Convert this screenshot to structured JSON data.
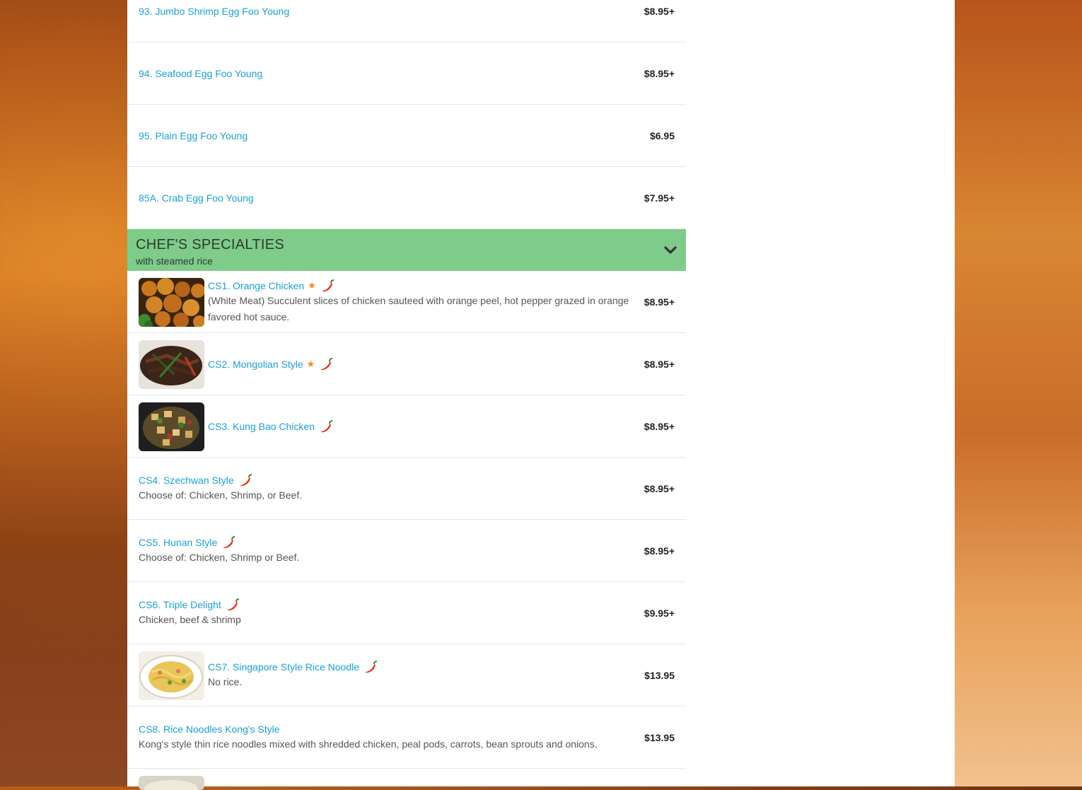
{
  "colors": {
    "link": "#1ba0d3",
    "price": "#222222",
    "section_bg": "#7fcb8a",
    "star": "#f08a24",
    "chili": "#e23a1f"
  },
  "egg_foo_young": [
    {
      "name": "93. Jumbo Shrimp Egg Foo Young",
      "price": "$8.95+"
    },
    {
      "name": "94. Seafood Egg Foo Young",
      "price": "$8.95+"
    },
    {
      "name": "95. Plain Egg Foo Young",
      "price": "$6.95"
    },
    {
      "name": "85A. Crab Egg Foo Young",
      "price": "$7.95+"
    }
  ],
  "section": {
    "title": "CHEF'S SPECIALTIES",
    "subtitle": "with steamed rice",
    "toggle_icon": "chevron-down-icon"
  },
  "specialties": [
    {
      "name": "CS1. Orange Chicken",
      "desc": "(White Meat) Succulent slices of chicken sauteed with orange peel, hot pepper grazed in orange favored hot sauce.",
      "price": "$8.95+",
      "popular": true,
      "spicy": true,
      "image": "orange-chicken-photo"
    },
    {
      "name": "CS2. Mongolian Style",
      "desc": "",
      "price": "$8.95+",
      "popular": true,
      "spicy": true,
      "image": "mongolian-photo"
    },
    {
      "name": "CS3. Kung Bao Chicken",
      "desc": "",
      "price": "$8.95+",
      "popular": false,
      "spicy": true,
      "image": "kung-bao-photo"
    },
    {
      "name": "CS4. Szechwan Style",
      "desc": "Choose of: Chicken, Shrimp, or Beef.",
      "price": "$8.95+",
      "popular": false,
      "spicy": true
    },
    {
      "name": "CS5. Hunan Style",
      "desc": "Choose of: Chicken, Shrimp or Beef.",
      "price": "$8.95+",
      "popular": false,
      "spicy": true
    },
    {
      "name": "CS6. Triple Delight",
      "desc": "Chicken, beef & shrimp",
      "price": "$9.95+",
      "popular": false,
      "spicy": true
    },
    {
      "name": "CS7. Singapore Style Rice Noodle",
      "desc": "No rice.",
      "price": "$13.95",
      "popular": false,
      "spicy": true,
      "image": "singapore-noodle-photo"
    },
    {
      "name": "CS8. Rice Noodles Kong's Style",
      "desc": "Kong's style thin rice noodles mixed with shredded chicken, peal pods, carrots, bean sprouts and onions.",
      "price": "$13.95",
      "popular": false,
      "spicy": false
    }
  ]
}
